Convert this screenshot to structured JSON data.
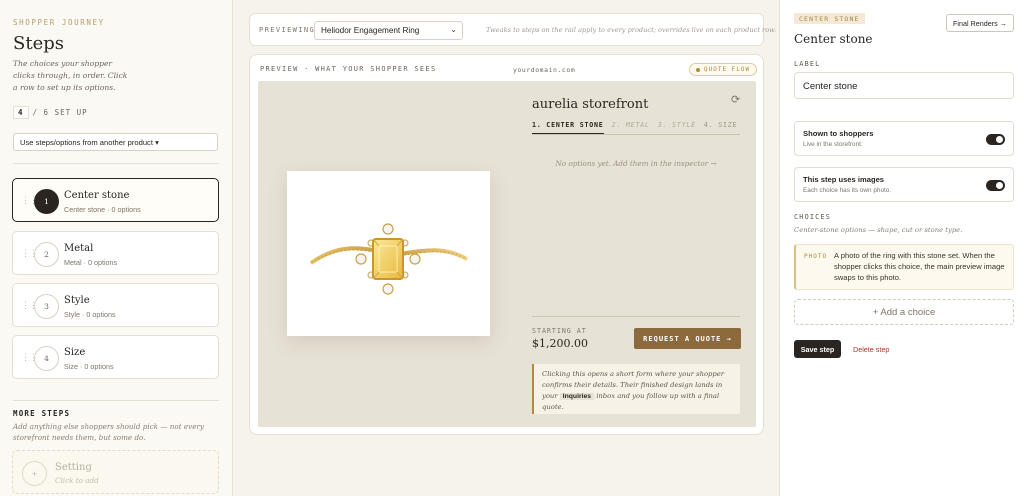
{
  "left": {
    "eyebrow": "SHOPPER JOURNEY",
    "title": "Steps",
    "description": "The choices your shopper clicks through, in order. Click a row to set up its options.",
    "count_done": "4",
    "count_rest": "/ 6 SET UP",
    "copy_select": "Use steps/options from another product ▾",
    "steps": [
      {
        "num": "1",
        "name": "Center stone",
        "meta": "Center stone · 0 options"
      },
      {
        "num": "2",
        "name": "Metal",
        "meta": "Metal · 0 options"
      },
      {
        "num": "3",
        "name": "Style",
        "meta": "Style · 0 options"
      },
      {
        "num": "4",
        "name": "Size",
        "meta": "Size · 0 options"
      }
    ],
    "more_title": "MORE STEPS",
    "more_desc": "Add anything else shoppers should pick — not every storefront needs them, but some do.",
    "ghost_step": {
      "icon": "+",
      "name": "Setting",
      "meta": "Click to add"
    }
  },
  "preview": {
    "label": "PREVIEWING",
    "product": "Heliodor Engagement Ring",
    "hint": "Tweaks to steps on the rail apply to every product; overrides live on each product row.",
    "canvas_label": "PREVIEW · WHAT YOUR SHOPPER SEES",
    "domain": "yourdomain.com",
    "flow_badge": "QUOTE FLOW",
    "store_name": "aurelia storefront",
    "tabs": [
      "1. CENTER STONE",
      "2. METAL",
      "3. STYLE",
      "4. SIZE"
    ],
    "empty_state": "No options yet. Add them in the inspector →",
    "starting_label": "STARTING AT",
    "price": "$1,200.00",
    "quote_button": "REQUEST A QUOTE →",
    "quote_note_before": "Clicking this opens a short form where your shopper confirms their details. Their finished design lands in your",
    "quote_note_chip": "Inquiries",
    "quote_note_after": "inbox and you follow up with a final quote."
  },
  "inspector": {
    "tag": "CENTER STONE",
    "final_renders": "Final Renders →",
    "title": "Center stone",
    "label_heading": "LABEL",
    "label_value": "Center stone",
    "toggles": [
      {
        "title": "Shown to shoppers",
        "sub": "Live in the storefront.",
        "on": true
      },
      {
        "title": "This step uses images",
        "sub": "Each choice has its own photo.",
        "on": true
      }
    ],
    "choices_heading": "CHOICES",
    "choices_sub": "Center-stone options — shape, cut or stone type.",
    "photo_key": "PHOTO",
    "photo_text": "A photo of the ring with this stone set. When the shopper clicks this choice, the main preview image swaps to this photo.",
    "add_choice": "+ Add a choice",
    "save": "Save step",
    "delete": "Delete step"
  },
  "colors": {
    "accent": "#8c6a3c",
    "dark": "#2a2520",
    "danger": "#a33a2e",
    "gold": "#b28a3b"
  }
}
